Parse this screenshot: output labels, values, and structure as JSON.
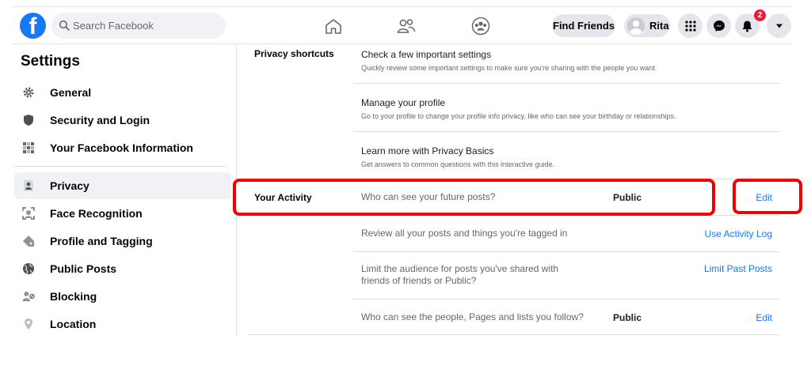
{
  "topbar": {
    "logo_letter": "f",
    "search_placeholder": "Search Facebook",
    "find_friends": "Find Friends",
    "profile_name": "Rita",
    "notification_count": "2",
    "nav_icons": [
      "home-icon",
      "friends-icon",
      "groups-icon"
    ],
    "action_icons": [
      "menu-grid-icon",
      "messenger-icon",
      "bell-icon",
      "caret-down-icon"
    ]
  },
  "sidebar": {
    "title": "Settings",
    "items": [
      {
        "label": "General",
        "icon": "gear-icon"
      },
      {
        "label": "Security and Login",
        "icon": "shield-icon"
      },
      {
        "label": "Your Facebook Information",
        "icon": "grid-icon"
      },
      {
        "label": "Privacy",
        "icon": "lock-person-icon"
      },
      {
        "label": "Face Recognition",
        "icon": "face-scan-icon"
      },
      {
        "label": "Profile and Tagging",
        "icon": "tag-icon"
      },
      {
        "label": "Public Posts",
        "icon": "globe-icon"
      },
      {
        "label": "Blocking",
        "icon": "block-user-icon"
      },
      {
        "label": "Location",
        "icon": "location-pin-icon"
      }
    ],
    "active_item": "Privacy"
  },
  "main": {
    "shortcuts": {
      "label": "Privacy shortcuts",
      "items": [
        {
          "title": "Check a few important settings",
          "subtitle": "Quickly review some important settings to make sure you're sharing with the people you want."
        },
        {
          "title": "Manage your profile",
          "subtitle": "Go to your profile to change your profile info privacy, like who can see your birthday or relationships."
        },
        {
          "title": "Learn more with Privacy Basics",
          "subtitle": "Get answers to common questions with this interactive guide."
        }
      ]
    },
    "activity": {
      "label": "Your Activity",
      "rows": [
        {
          "question": "Who can see your future posts?",
          "value": "Public",
          "action": "Edit"
        },
        {
          "question": "Review all your posts and things you're tagged in",
          "value": "",
          "action": "Use Activity Log"
        },
        {
          "question_line1": "Limit the audience for posts you've shared with",
          "question_line2": "friends of friends or Public?",
          "value": "",
          "action": "Limit Past Posts"
        },
        {
          "question": "Who can see the people, Pages and lists you follow?",
          "value": "Public",
          "action": "Edit"
        }
      ]
    }
  },
  "colors": {
    "brand": "#1877f2",
    "highlight": "#ee0000",
    "badge": "#e41e3f"
  }
}
